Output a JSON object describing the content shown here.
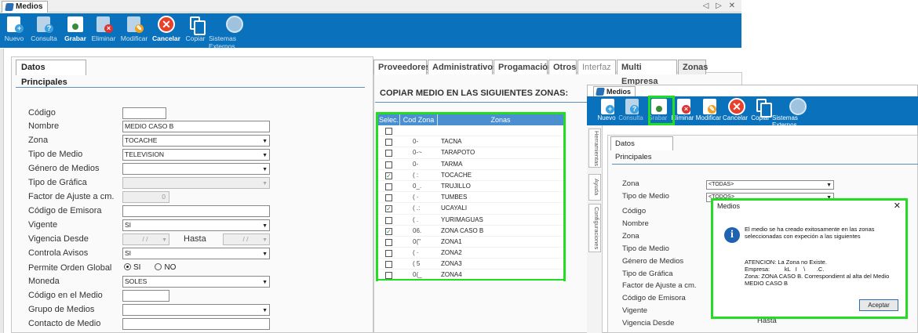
{
  "window": {
    "title": "Medios",
    "controls": "◁ ▷ ✕"
  },
  "toolbar": [
    {
      "name": "nuevo",
      "label": "Nuevo",
      "active": false
    },
    {
      "name": "consulta",
      "label": "Consulta",
      "active": false
    },
    {
      "name": "grabar",
      "label": "Grabar",
      "active": true
    },
    {
      "name": "eliminar",
      "label": "Eliminar",
      "active": false
    },
    {
      "name": "modificar",
      "label": "Modificar",
      "active": false
    },
    {
      "name": "cancelar",
      "label": "Cancelar",
      "active": true
    },
    {
      "name": "copiar",
      "label": "Copiar",
      "active": false
    },
    {
      "name": "sistemas",
      "label": "Sistemas Externos",
      "active": false
    }
  ],
  "left_tab": "Datos Principales",
  "form": {
    "codigo_label": "Código",
    "codigo_value": "",
    "nombre_label": "Nombre",
    "nombre_value": "MEDIO CASO B",
    "zona_label": "Zona",
    "zona_value": "TOCACHE",
    "tipo_medio_label": "Tipo de Medio",
    "tipo_medio_value": "TELEVISION",
    "genero_label": "Género de Medios",
    "genero_value": "",
    "tipo_grafica_label": "Tipo de Gráfica",
    "tipo_grafica_value": "",
    "factor_label": "Factor de Ajuste a cm.",
    "factor_value": "0",
    "emisora_label": "Código de Emisora",
    "emisora_value": "",
    "vigente_label": "Vigente",
    "vigente_value": "SI",
    "vig_desde_label": "Vigencia Desde",
    "vig_desde_value": "/ /",
    "hasta_label": "Hasta",
    "hasta_value": "/ /",
    "controla_label": "Controla Avisos",
    "controla_value": "SI",
    "permite_label": "Permite Orden Global",
    "radio_si": "SI",
    "radio_no": "NO",
    "moneda_label": "Moneda",
    "moneda_value": "SOLES",
    "cod_medio_label": "Código en el Medio",
    "cod_medio_value": "",
    "grupo_label": "Grupo de Medios",
    "grupo_value": "",
    "contacto_label": "Contacto de Medio",
    "contacto_value": ""
  },
  "right_tabs": [
    "Proveedores",
    "Administrativos",
    "Progamación",
    "Otros",
    "Interfaz",
    "Multi Empresa",
    "Zonas"
  ],
  "copy_title": "COPIAR MEDIO EN LAS SIGUIENTES ZONAS:",
  "grid": {
    "headers": [
      "Selec.",
      "Cod Zona",
      "Zonas"
    ],
    "rows": [
      {
        "checked": false,
        "code": "",
        "zone": ""
      },
      {
        "checked": false,
        "code": "0-",
        "zone": "TACNA"
      },
      {
        "checked": false,
        "code": "0-~",
        "zone": "TARAPOTO"
      },
      {
        "checked": false,
        "code": "0-",
        "zone": "TARMA"
      },
      {
        "checked": true,
        "code": "( :",
        "zone": "TOCACHE"
      },
      {
        "checked": false,
        "code": "0_.",
        "zone": "TRUJILLO"
      },
      {
        "checked": false,
        "code": "( ·",
        "zone": "TUMBES"
      },
      {
        "checked": true,
        "code": "( .:",
        "zone": "UCAYALI"
      },
      {
        "checked": false,
        "code": "( .",
        "zone": "YURIMAGUAS"
      },
      {
        "checked": true,
        "code": "06.",
        "zone": "ZONA CASO B"
      },
      {
        "checked": false,
        "code": "0(\"",
        "zone": "ZONA1"
      },
      {
        "checked": false,
        "code": "( ·",
        "zone": "ZONA2"
      },
      {
        "checked": false,
        "code": "( 5",
        "zone": "ZONA3"
      },
      {
        "checked": false,
        "code": "0(_",
        "zone": "ZONA4"
      }
    ]
  },
  "win2": {
    "title": "Medios",
    "toolbar": [
      {
        "name": "nuevo",
        "label": "Nuevo",
        "dim": false
      },
      {
        "name": "consulta",
        "label": "Consulta",
        "dim": true
      },
      {
        "name": "grabar",
        "label": "Grabar",
        "dim": true
      },
      {
        "name": "eliminar",
        "label": "Eliminar",
        "dim": false
      },
      {
        "name": "modificar",
        "label": "Modificar",
        "dim": false
      },
      {
        "name": "cancelar",
        "label": "Cancelar",
        "dim": false
      },
      {
        "name": "copiar",
        "label": "Copiar",
        "dim": false
      },
      {
        "name": "sistemas",
        "label": "Sistemas Externos",
        "dim": false
      }
    ],
    "vtabs": [
      "Herramientas",
      "Ayuda",
      "Configuraciones"
    ],
    "tab": "Datos Principales",
    "zona_label": "Zona",
    "zona_value": "<TODAS>",
    "tipo_label": "Tipo de Medio",
    "tipo_value": "<TODOS>",
    "labels": [
      "Código",
      "Nombre",
      "Zona",
      "Tipo de Medio",
      "Género de Medios",
      "Tipo de Gráfica",
      "Factor de Ajuste a cm.",
      "Código de Emisora",
      "Vigente",
      "Vigencia Desde"
    ],
    "hasta_label": "Hasta"
  },
  "dialog": {
    "title": "Medios",
    "close": "✕",
    "line1": "El medio se ha creado exitosamente en las zonas",
    "line2": "seleccionadas con expeción a las siguientes",
    "line3": "ATENCION: La Zona no Existe.",
    "line4": "Empresa:         kL   I    \\       .C.",
    "line5": "Zona: ZONA CASO B. Correspondient al alta del Medio",
    "line6": "MEDIO CASO B",
    "button": "Aceptar"
  }
}
